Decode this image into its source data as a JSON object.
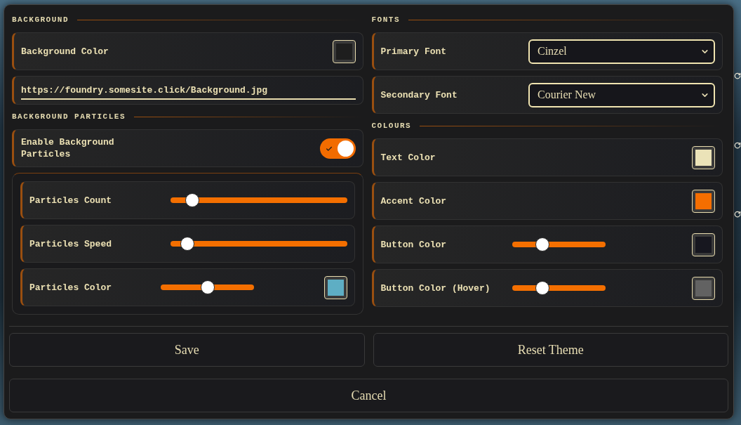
{
  "background": {
    "heading": "BACKGROUND",
    "settings": [
      {
        "kind": "swatch",
        "label": "Background Color",
        "color": "#1e1e1e"
      },
      {
        "kind": "url",
        "value": "https://foundry.somesite.click/Background.jpg"
      }
    ]
  },
  "background_particles": {
    "heading": "BACKGROUND PARTICLES",
    "settings": [
      {
        "kind": "toggle",
        "label": "Enable Background Particles",
        "on": true
      }
    ],
    "group": [
      {
        "kind": "slider",
        "label": "Particles Count",
        "level": 0.09
      },
      {
        "kind": "slider",
        "label": "Particles Speed",
        "level": 0.06
      },
      {
        "kind": "swatch_slider",
        "label": "Particles Color",
        "level": 0.5,
        "color": "#5eaec4"
      }
    ]
  },
  "fonts": {
    "heading": "FONTS",
    "settings": [
      {
        "kind": "select",
        "label": "Primary Font",
        "value": "Cinzel"
      },
      {
        "kind": "select",
        "label": "Secondary Font",
        "value": "Courier New"
      }
    ]
  },
  "colours": {
    "heading": "COLOURS",
    "settings": [
      {
        "kind": "swatch",
        "label": "Text Color",
        "color": "#ebe3b8"
      },
      {
        "kind": "swatch",
        "label": "Accent Color",
        "color": "#f56e00"
      },
      {
        "kind": "swatch_slider",
        "label": "Button Color",
        "level": 0.3,
        "color": "#17171f"
      },
      {
        "kind": "swatch_slider",
        "label": "Button Color (Hover)",
        "level": 0.3,
        "color": "#626262"
      }
    ]
  },
  "buttons": [
    {
      "label": "Save"
    },
    {
      "label": "Reset Theme"
    },
    {
      "label": "Cancel"
    }
  ]
}
